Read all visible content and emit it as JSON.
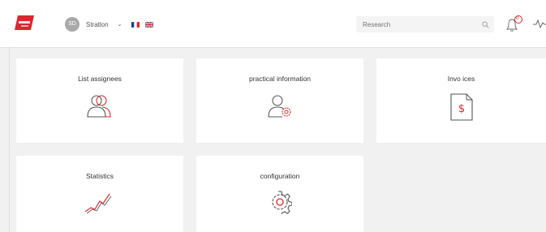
{
  "header": {
    "user_initials": "SD",
    "user_name": "Stratlon",
    "search_placeholder": "Research",
    "notification_count": "0"
  },
  "cards": {
    "list_assignees": "List assignees",
    "practical_information": "practical information",
    "invoices": "Invo ices",
    "statistics": "Statistics",
    "configuration": "configuration"
  },
  "colors": {
    "accent": "#d9282f",
    "icon_gray": "#555555"
  }
}
